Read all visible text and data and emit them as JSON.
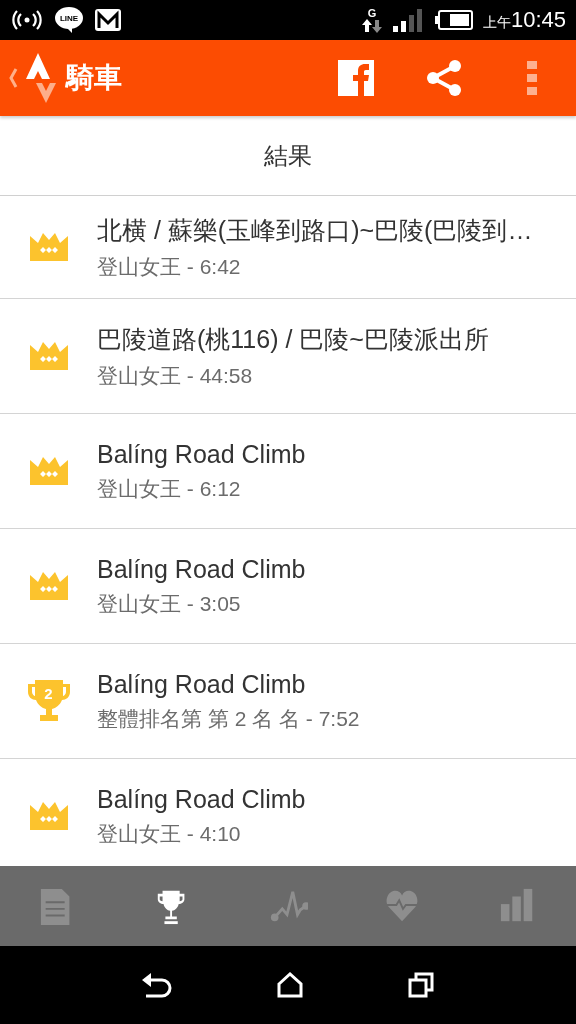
{
  "status_bar": {
    "line_label": "LINE",
    "network_label": "G",
    "time_prefix": "上午",
    "time": "10:45"
  },
  "app_bar": {
    "title": "騎車"
  },
  "header": {
    "title": "結果"
  },
  "results": [
    {
      "kind": "crown",
      "title": "北横 / 蘇樂(玉峰到路口)~巴陵(巴陵到…",
      "subtitle": "登山女王 - 6:42"
    },
    {
      "kind": "crown",
      "title": "巴陵道路(桃116) / 巴陵~巴陵派出所",
      "subtitle": "登山女王 - 44:58"
    },
    {
      "kind": "crown",
      "title": "Balíng Road Climb",
      "subtitle": "登山女王 - 6:12"
    },
    {
      "kind": "crown",
      "title": "Balíng Road Climb",
      "subtitle": "登山女王 - 3:05"
    },
    {
      "kind": "trophy",
      "badge": "2",
      "title": "Balíng Road Climb",
      "subtitle": "整體排名第 第 2 名 名 - 7:52"
    },
    {
      "kind": "crown",
      "title": "Balíng Road Climb",
      "subtitle": "登山女王 - 4:10"
    }
  ],
  "tabs": [
    {
      "kind": "overview",
      "selected": false
    },
    {
      "kind": "trophy",
      "selected": true
    },
    {
      "kind": "analysis",
      "selected": false
    },
    {
      "kind": "heart",
      "selected": false
    },
    {
      "kind": "stats",
      "selected": false
    }
  ]
}
